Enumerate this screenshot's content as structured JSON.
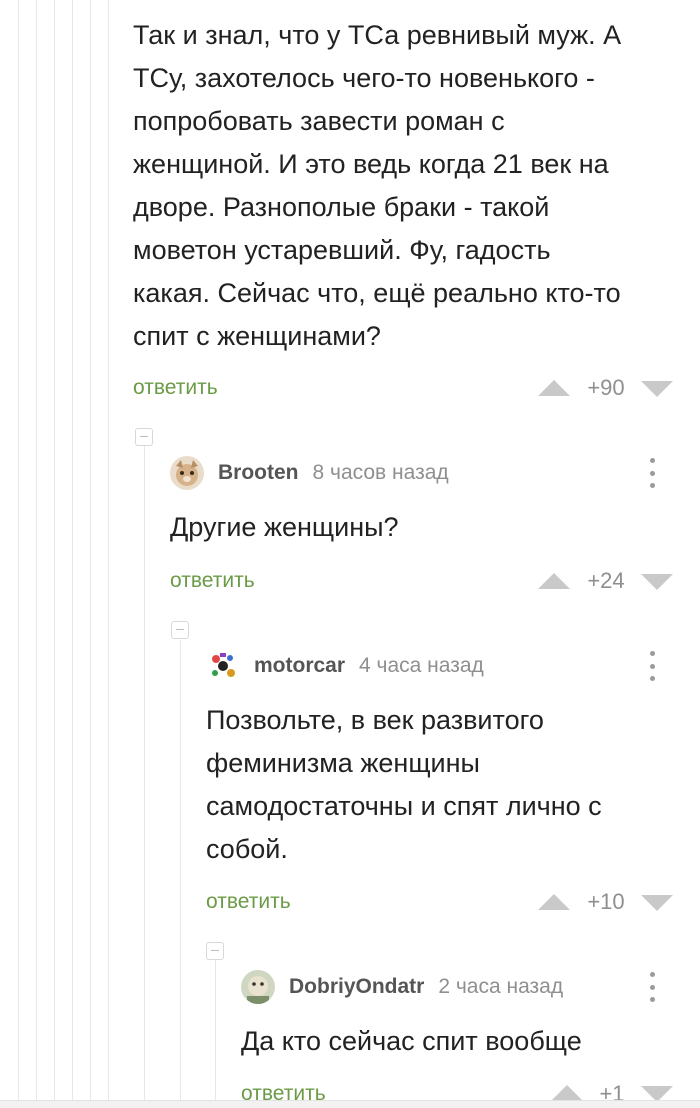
{
  "root_comment": {
    "lines": [
      "Так и знал, что у ТСа ревнивый муж. А",
      "ТСу, захотелось чего-то новенького -",
      "попробовать завести роман с",
      "женщиной. И это ведь когда 21 век на",
      "дворе. Разнополые браки - такой",
      "моветон устаревший. Фу, гадость",
      "какая. Сейчас что, ещё реально кто-то",
      "спит с женщинами?"
    ],
    "reply_label": "ответить",
    "rating": "+90"
  },
  "comments": [
    {
      "username": "Brooten",
      "time": "8 часов назад",
      "lines": [
        "Другие женщины?"
      ],
      "reply_label": "ответить",
      "rating": "+24"
    },
    {
      "username": "motorcar",
      "time": "4 часа назад",
      "lines": [
        "Позвольте, в век развитого",
        "феминизма женщины",
        "самодостаточны и спят лично с",
        "собой."
      ],
      "reply_label": "ответить",
      "rating": "+10"
    },
    {
      "username": "DobriyOndatr",
      "time": "2 часа назад",
      "lines": [
        "Да кто сейчас спит вообще"
      ],
      "reply_label": "ответить",
      "rating": "+1"
    }
  ],
  "icons": {
    "collapse": "minus-box-icon",
    "vote_up": "triangle-up-icon",
    "vote_down": "triangle-down-icon",
    "menu": "vertical-dots-icon"
  },
  "colors": {
    "reply_link": "#6b9b47",
    "text": "#222222",
    "meta": "#8f8f8f",
    "vote_arrow": "#c9c9c9"
  }
}
